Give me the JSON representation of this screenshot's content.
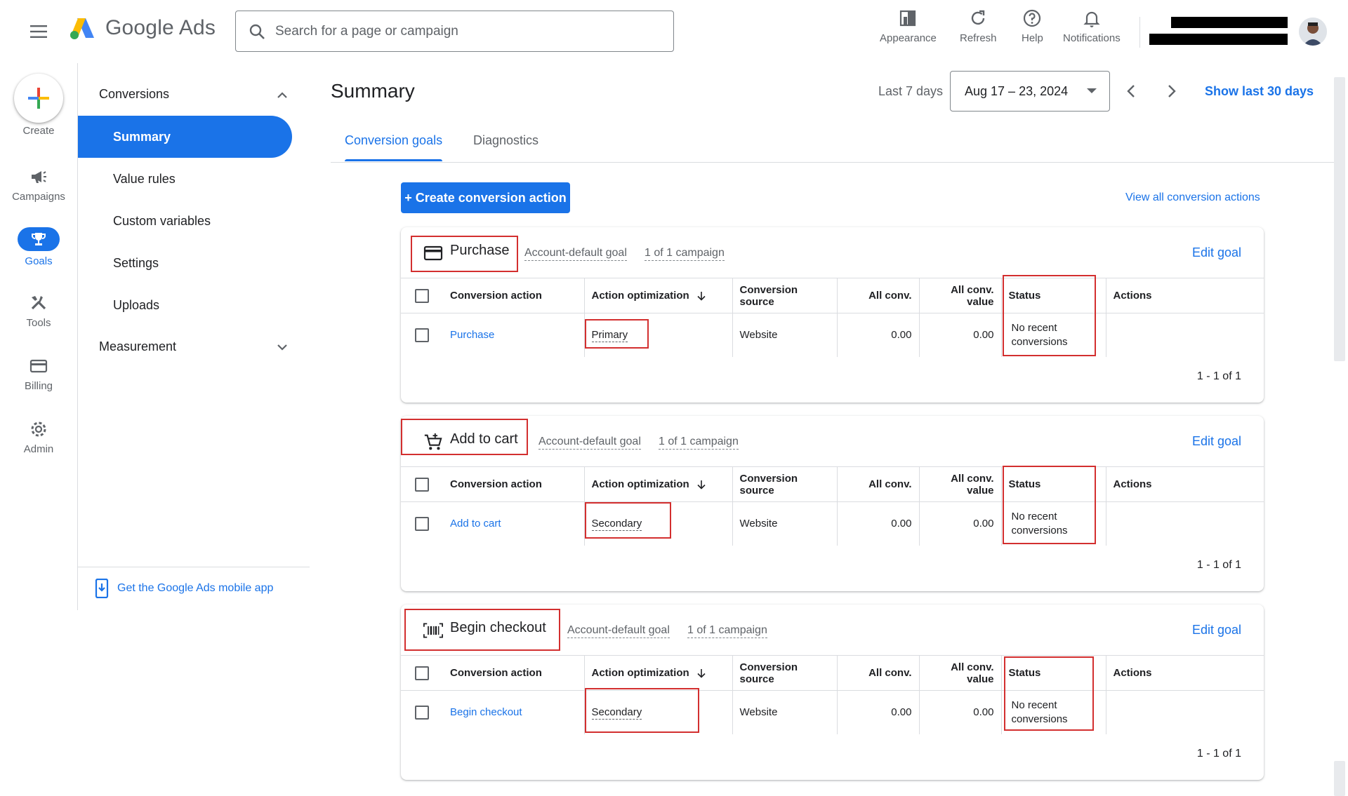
{
  "header": {
    "logo_text": "Google Ads",
    "search_placeholder": "Search for a page or campaign",
    "actions": {
      "appearance": "Appearance",
      "refresh": "Refresh",
      "help": "Help",
      "notifications": "Notifications"
    }
  },
  "rail": {
    "create": "Create",
    "campaigns": "Campaigns",
    "goals": "Goals",
    "tools": "Tools",
    "billing": "Billing",
    "admin": "Admin"
  },
  "subnav": {
    "section": "Conversions",
    "items": [
      "Summary",
      "Value rules",
      "Custom variables",
      "Settings",
      "Uploads"
    ],
    "measurement": "Measurement",
    "mobile_app": "Get the Google Ads mobile app"
  },
  "main": {
    "title": "Summary",
    "date_label": "Last 7 days",
    "date_range": "Aug 17 – 23, 2024",
    "show_last_30": "Show last 30 days",
    "tabs": [
      "Conversion goals",
      "Diagnostics"
    ],
    "create_action": "+ Create conversion action",
    "view_all": "View all conversion actions"
  },
  "table_headers": {
    "action": "Conversion action",
    "optimization": "Action optimization",
    "source": "Conversion source",
    "all_conv": "All conv.",
    "all_conv_value": "All conv. value",
    "status": "Status",
    "actions": "Actions"
  },
  "goals": [
    {
      "title": "Purchase",
      "goal_type": "Account-default goal",
      "campaigns": "1 of 1 campaign",
      "edit": "Edit goal",
      "row": {
        "action": "Purchase",
        "optimization": "Primary",
        "source": "Website",
        "all_conv": "0.00",
        "all_conv_value": "0.00",
        "status": "No recent conversions"
      },
      "pager": "1 - 1 of 1"
    },
    {
      "title": "Add to cart",
      "goal_type": "Account-default goal",
      "campaigns": "1 of 1 campaign",
      "edit": "Edit goal",
      "row": {
        "action": "Add to cart",
        "optimization": "Secondary",
        "source": "Website",
        "all_conv": "0.00",
        "all_conv_value": "0.00",
        "status": "No recent conversions"
      },
      "pager": "1 - 1 of 1"
    },
    {
      "title": "Begin checkout",
      "goal_type": "Account-default goal",
      "campaigns": "1 of 1 campaign",
      "edit": "Edit goal",
      "row": {
        "action": "Begin checkout",
        "optimization": "Secondary",
        "source": "Website",
        "all_conv": "0.00",
        "all_conv_value": "0.00",
        "status": "No recent conversions"
      },
      "pager": "1 - 1 of 1"
    }
  ],
  "colors": {
    "accent": "#1a73e8",
    "highlight": "#d32f2f",
    "text": "#202124",
    "muted": "#5f6368"
  }
}
